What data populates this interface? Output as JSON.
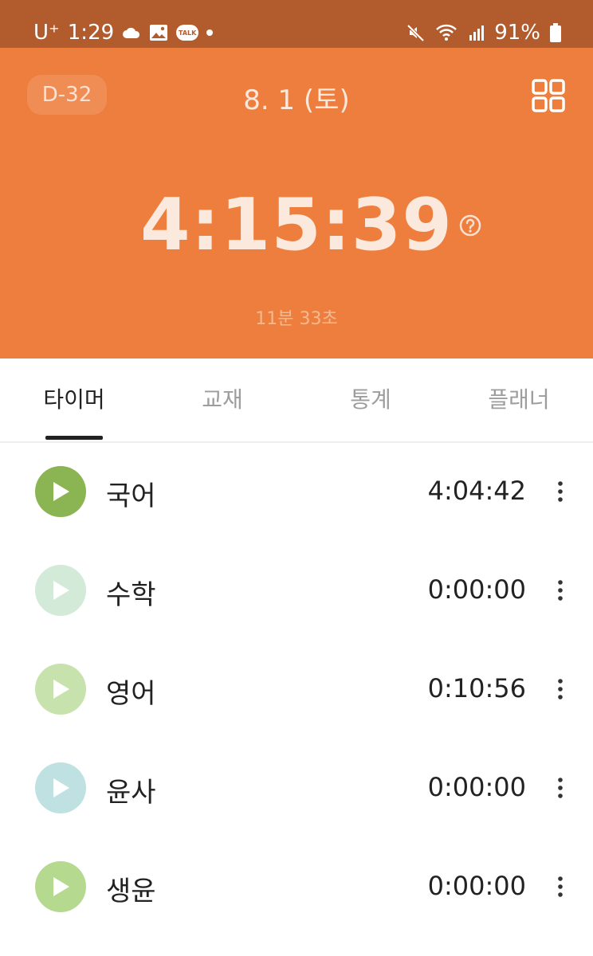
{
  "statusbar": {
    "carrier": "U⁺",
    "time": "1:29",
    "talk_label": "TALK",
    "battery": "91%"
  },
  "header": {
    "dday": "D-32",
    "date": "8. 1 (토)",
    "total_time": "4:15:39",
    "sub_time": "11분 33초"
  },
  "tabs": [
    {
      "label": "타이머",
      "active": true
    },
    {
      "label": "교재",
      "active": false
    },
    {
      "label": "통계",
      "active": false
    },
    {
      "label": "플래너",
      "active": false
    }
  ],
  "subjects": [
    {
      "name": "국어",
      "time": "4:04:42",
      "color": "#8ab552"
    },
    {
      "name": "수학",
      "time": "0:00:00",
      "color": "#d3ead8"
    },
    {
      "name": "영어",
      "time": "0:10:56",
      "color": "#c8e2ad"
    },
    {
      "name": "윤사",
      "time": "0:00:00",
      "color": "#bfe1e1"
    },
    {
      "name": "생윤",
      "time": "0:00:00",
      "color": "#b5d98f"
    }
  ],
  "colors": {
    "statusbar": "#b25c2e",
    "header": "#ee7e3e"
  }
}
